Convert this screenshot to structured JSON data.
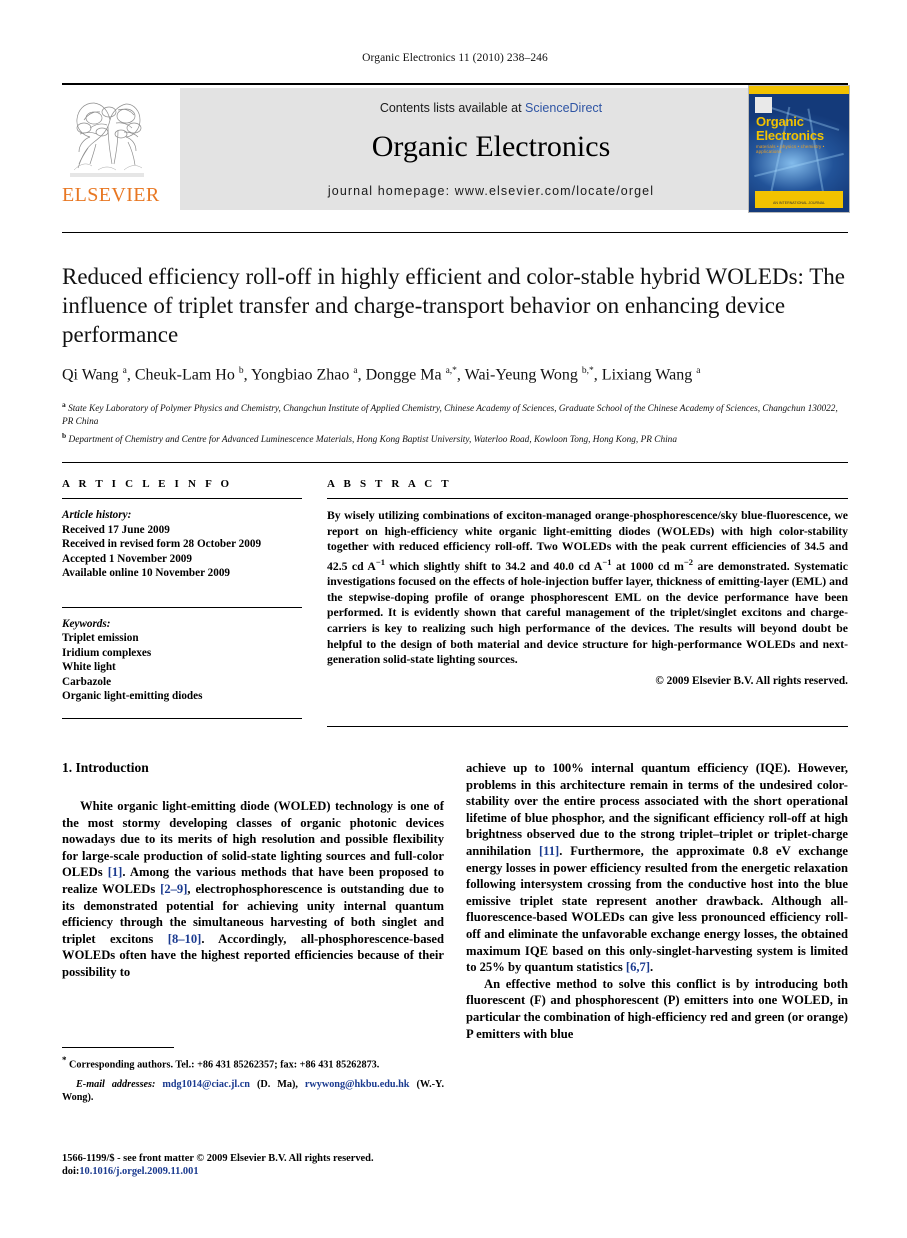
{
  "running_head": "Organic Electronics 11 (2010) 238–246",
  "masthead": {
    "contents_prefix": "Contents lists available at ",
    "sciencedirect": "ScienceDirect",
    "journal_title": "Organic Electronics",
    "homepage": "journal homepage: www.elsevier.com/locate/orgel",
    "publisher_name": "ELSEVIER",
    "cover": {
      "title_line1": "Organic",
      "title_line2": "Electronics",
      "subtitle": "materials • physics • chemistry • applications",
      "bottom_text": "AN INTERNATIONAL JOURNAL"
    },
    "accent_orange": "#E87722",
    "link_blue": "#2f55a4",
    "cover_blue": "#143a7a",
    "cover_yellow": "#f2c200"
  },
  "article": {
    "title": "Reduced efficiency roll-off in highly efficient and color-stable hybrid WOLEDs: The influence of triplet transfer and charge-transport behavior on enhancing device performance",
    "authors_html": "Qi Wang <sup>a</sup>, Cheuk-Lam Ho <sup>b</sup>, Yongbiao Zhao <sup>a</sup>, Dongge Ma <sup>a,</sup><sup>*</sup>, Wai-Yeung Wong <sup>b,</sup><sup>*</sup>, Lixiang Wang <sup>a</sup>",
    "affiliation_a": "State Key Laboratory of Polymer Physics and Chemistry, Changchun Institute of Applied Chemistry, Chinese Academy of Sciences, Graduate School of the Chinese Academy of Sciences, Changchun 130022, PR China",
    "affiliation_b": "Department of Chemistry and Centre for Advanced Luminescence Materials, Hong Kong Baptist University, Waterloo Road, Kowloon Tong, Hong Kong, PR China"
  },
  "article_info": {
    "heading": "A R T I C L E  I N F O",
    "history_title": "Article history:",
    "history": [
      "Received 17 June 2009",
      "Received in revised form 28 October 2009",
      "Accepted 1 November 2009",
      "Available online 10 November 2009"
    ],
    "keywords_title": "Keywords:",
    "keywords": [
      "Triplet emission",
      "Iridium complexes",
      "White light",
      "Carbazole",
      "Organic light-emitting diodes"
    ]
  },
  "abstract": {
    "heading": "A B S T R A C T",
    "text_html": "By wisely utilizing combinations of exciton-managed orange-phosphorescence/sky blue-fluorescence, we report on high-efficiency white organic light-emitting diodes (WOLEDs) with high color-stability together with reduced efficiency roll-off. Two WOLEDs with the peak current efficiencies of 34.5 and 42.5 cd A<sup>&minus;1</sup> which slightly shift to 34.2 and 40.0 cd A<sup>&minus;1</sup> at 1000 cd m<sup>&minus;2</sup> are demonstrated. Systematic investigations focused on the effects of hole-injection buffer layer, thickness of emitting-layer (EML) and the stepwise-doping profile of orange phosphorescent EML on the device performance have been performed. It is evidently shown that careful management of the triplet/singlet excitons and charge-carriers is key to realizing such high performance of the devices. The results will beyond doubt be helpful to the design of both material and device structure for high-performance WOLEDs and next-generation solid-state lighting sources.",
    "copyright": "© 2009 Elsevier B.V. All rights reserved."
  },
  "body": {
    "section_title": "1. Introduction",
    "left_paragraph_html": "White organic light-emitting diode (WOLED) technology is one of the most stormy developing classes of organic photonic devices nowadays due to its merits of high resolution and possible flexibility for large-scale production of solid-state lighting sources and full-color OLEDs <span class=\"ref\">[1]</span>. Among the various methods that have been proposed to realize WOLEDs <span class=\"ref\">[2–9]</span>, electrophosphorescence is outstanding due to its demonstrated potential for achieving unity internal quantum efficiency through the simultaneous harvesting of both singlet and triplet excitons <span class=\"ref\">[8–10]</span>. Accordingly, all-phosphorescence-based WOLEDs often have the highest reported efficiencies because of their possibility to",
    "right_paragraph_1_html": "achieve up to 100% internal quantum efficiency (IQE). However, problems in this architecture remain in terms of the undesired color-stability over the entire process associated with the short operational lifetime of blue phosphor, and the significant efficiency roll-off at high brightness observed due to the strong triplet–triplet or triplet-charge annihilation <span class=\"ref\">[11]</span>. Furthermore, the approximate 0.8 eV exchange energy losses in power efficiency resulted from the energetic relaxation following intersystem crossing from the conductive host into the blue emissive triplet state represent another drawback. Although all-fluorescence-based WOLEDs can give less pronounced efficiency roll-off and eliminate the unfavorable exchange energy losses, the obtained maximum IQE based on this only-singlet-harvesting system is limited to 25% by quantum statistics <span class=\"ref\">[6,7]</span>.",
    "right_paragraph_2_html": "An effective method to solve this conflict is by introducing both fluorescent (F) and phosphorescent (P) emitters into one WOLED, in particular the combination of high-efficiency red and green (or orange) P emitters with blue"
  },
  "footnotes": {
    "corresponding_html": "<span class=\"fn-star\">*</span> Corresponding authors. Tel.: +86 431 85262357; fax: +86 431 85262873.",
    "email_html": "<span class=\"email-lead\">E-mail addresses:</span> <span class=\"link\">mdg1014@ciac.jl.cn</span> (D. Ma), <span class=\"link\">rwywong@hkbu.edu.hk</span> (W.-Y. Wong).",
    "frontmatter_line1": "1566-1199/$ - see front matter © 2009 Elsevier B.V. All rights reserved.",
    "frontmatter_doi_label": "doi:",
    "frontmatter_doi": "10.1016/j.orgel.2009.11.001"
  }
}
